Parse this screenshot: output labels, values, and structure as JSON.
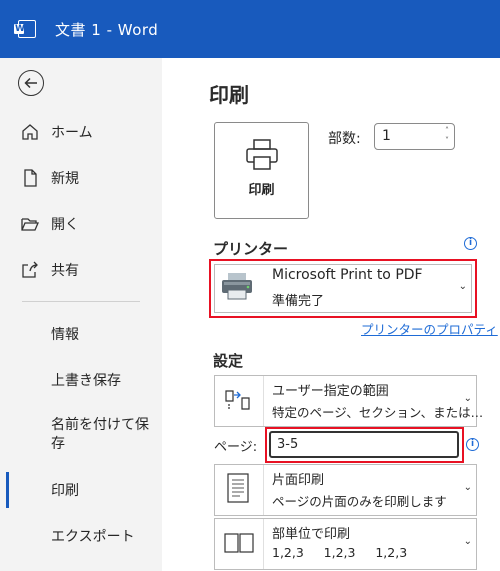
{
  "window": {
    "title": "文書 1  -  Word"
  },
  "sidebar": {
    "items": [
      {
        "label": "ホーム",
        "icon": "home-icon"
      },
      {
        "label": "新規",
        "icon": "new-document-icon"
      },
      {
        "label": "開く",
        "icon": "folder-open-icon"
      },
      {
        "label": "共有",
        "icon": "share-icon"
      },
      {
        "label": "情報"
      },
      {
        "label": "上書き保存"
      },
      {
        "label": "名前を付けて保\n存"
      },
      {
        "label": "印刷",
        "active": true
      },
      {
        "label": "エクスポート"
      }
    ]
  },
  "main": {
    "title": "印刷",
    "print_button_label": "印刷",
    "copies_label": "部数:",
    "copies_value": "1",
    "printer_section_title": "プリンター",
    "printer": {
      "name": "Microsoft Print to PDF",
      "status": "準備完了"
    },
    "printer_properties_link": "プリンターのプロパティ",
    "settings_section_title": "設定",
    "range": {
      "title": "ユーザー指定の範囲",
      "subtitle": "特定のページ、セクション、または…"
    },
    "pages_label": "ページ:",
    "pages_value": "3-5",
    "sides": {
      "title": "片面印刷",
      "subtitle": "ページの片面のみを印刷します"
    },
    "collation": {
      "title": "部単位で印刷",
      "subtitle": "1,2,3     1,2,3     1,2,3"
    }
  },
  "colors": {
    "titlebar": "#185abd",
    "highlight": "#e81123",
    "link": "#1e6bd6"
  }
}
